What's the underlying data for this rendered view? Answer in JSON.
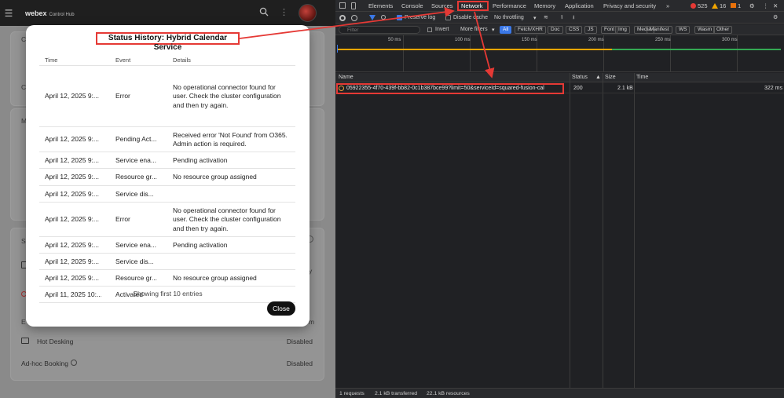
{
  "app": {
    "brand": "webex",
    "brand_sub": "Control Hub",
    "bg_rows": [
      {
        "label": "Hot Desking",
        "value": "Disabled"
      },
      {
        "label": "Ad-hoc Booking",
        "value": "Disabled"
      }
    ],
    "bg_fragments": {
      "c1": "C",
      "c2": "C",
      "m": "M",
      "s": "S",
      "e": "E",
      "y": "y",
      "m2": "m"
    }
  },
  "modal": {
    "title": "Status History: Hybrid Calendar Service",
    "headers": {
      "time": "Time",
      "event": "Event",
      "details": "Details"
    },
    "rows": [
      {
        "time": "April 12, 2025 9:...",
        "event": "Error",
        "details": "No operational connector found for user. Check the cluster configuration and then try again."
      },
      {
        "time": "April 12, 2025 9:...",
        "event": "Pending Act...",
        "details": "Received error 'Not Found' from O365. Admin action is required."
      },
      {
        "time": "April 12, 2025 9:...",
        "event": "Service ena...",
        "details": "Pending activation"
      },
      {
        "time": "April 12, 2025 9:...",
        "event": "Resource gr...",
        "details": "No resource group assigned"
      },
      {
        "time": "April 12, 2025 9:...",
        "event": "Service dis...",
        "details": ""
      },
      {
        "time": "April 12, 2025 9:...",
        "event": "Error",
        "details": "No operational connector found for user. Check the cluster configuration and then try again."
      },
      {
        "time": "April 12, 2025 9:...",
        "event": "Service ena...",
        "details": "Pending activation"
      },
      {
        "time": "April 12, 2025 9:...",
        "event": "Service dis...",
        "details": ""
      },
      {
        "time": "April 12, 2025 9:...",
        "event": "Resource gr...",
        "details": "No resource group assigned"
      },
      {
        "time": "April 11, 2025 10:...",
        "event": "Activated",
        "details": ""
      }
    ],
    "footer": "Showing first 10 entries",
    "close_label": "Close"
  },
  "devtools": {
    "tabs": [
      "Elements",
      "Console",
      "Sources",
      "Network",
      "Performance",
      "Memory",
      "Application",
      "Privacy and security"
    ],
    "more_tabs": "»",
    "badges": {
      "errors": "525",
      "warnings": "16",
      "issues": "1"
    },
    "toolbar": {
      "preserve_log": "Preserve log",
      "disable_cache": "Disable cache",
      "throttling": "No throttling"
    },
    "filter": {
      "placeholder": "Filter",
      "invert": "Invert",
      "more_filters": "More filters"
    },
    "type_filters": [
      "All",
      "Fetch/XHR",
      "Doc",
      "CSS",
      "JS",
      "Font",
      "Img",
      "Media",
      "Manifest",
      "WS",
      "Wasm",
      "Other"
    ],
    "timeline_labels": [
      "50 ms",
      "100 ms",
      "150 ms",
      "200 ms",
      "250 ms",
      "300 ms"
    ],
    "columns": {
      "name": "Name",
      "status": "Status",
      "size": "Size",
      "time": "Time"
    },
    "request": {
      "name": "05922355-4f70-439f-bb82-0c1b387bce99?limit=50&serviceId=squared-fusion-cal",
      "status": "200",
      "size": "2.1 kB",
      "time": "322 ms"
    },
    "statusbar": {
      "requests": "1 requests",
      "transferred": "2.1 kB transferred",
      "resources": "22.1 kB resources"
    },
    "colors": {
      "accent": "#3b78e7",
      "annotation": "#e53935"
    }
  }
}
